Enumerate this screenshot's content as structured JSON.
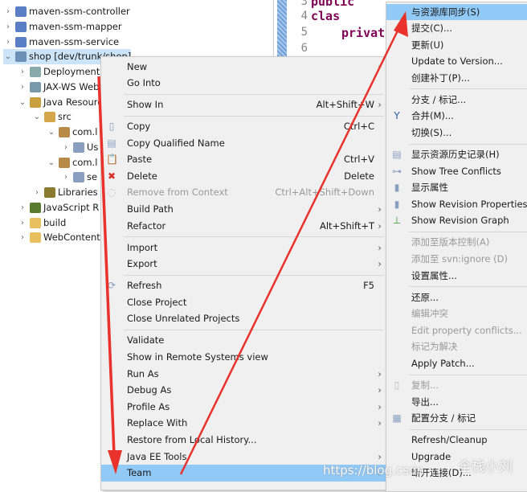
{
  "tree": [
    {
      "label": "maven-ssm-controller",
      "indent": 0,
      "chev": "›",
      "icon": "maven-project-icon",
      "color": "#5b7fc7"
    },
    {
      "label": "maven-ssm-mapper",
      "indent": 0,
      "chev": "›",
      "icon": "maven-project-icon",
      "color": "#5b7fc7"
    },
    {
      "label": "maven-ssm-service",
      "indent": 0,
      "chev": "›",
      "icon": "maven-project-icon",
      "color": "#5b7fc7"
    },
    {
      "label": "shop [dev/trunk/shop]",
      "indent": 0,
      "chev": "⌄",
      "icon": "svn-project-icon",
      "color": "#6b8fb5",
      "selected": true
    },
    {
      "label": "Deployment",
      "indent": 1,
      "chev": "›",
      "icon": "deployment-icon",
      "color": "#8aa"
    },
    {
      "label": "JAX-WS Web",
      "indent": 1,
      "chev": "›",
      "icon": "webservice-icon",
      "color": "#79a"
    },
    {
      "label": "Java Resources",
      "indent": 1,
      "chev": "⌄",
      "icon": "java-resources-icon",
      "color": "#c9a040"
    },
    {
      "label": "src",
      "indent": 2,
      "chev": "⌄",
      "icon": "source-folder-icon",
      "color": "#d6a64a"
    },
    {
      "label": "com.l",
      "indent": 3,
      "chev": "⌄",
      "icon": "package-icon",
      "color": "#b88a4a"
    },
    {
      "label": "Us",
      "indent": 4,
      "chev": "›",
      "icon": "java-file-icon",
      "color": "#8a9fc0"
    },
    {
      "label": "com.l",
      "indent": 3,
      "chev": "⌄",
      "icon": "package-icon",
      "color": "#b88a4a"
    },
    {
      "label": "se",
      "indent": 4,
      "chev": "›",
      "icon": "java-file-icon",
      "color": "#8a9fc0"
    },
    {
      "label": "Libraries",
      "indent": 2,
      "chev": "›",
      "icon": "libraries-icon",
      "color": "#8a7a30"
    },
    {
      "label": "JavaScript R",
      "indent": 1,
      "chev": "›",
      "icon": "javascript-resources-icon",
      "color": "#5a7a30"
    },
    {
      "label": "build",
      "indent": 1,
      "chev": "›",
      "icon": "folder-icon",
      "color": "#e8c060"
    },
    {
      "label": "WebContent",
      "indent": 1,
      "chev": "›",
      "icon": "folder-icon",
      "color": "#e8c060"
    }
  ],
  "editor": {
    "lines": [
      "3",
      "4",
      "5",
      "6"
    ],
    "code_line3": "public clas",
    "code_line5": "privat"
  },
  "main_menu": [
    {
      "label": "New",
      "arrow": true
    },
    {
      "label": "Go Into"
    },
    {
      "sep": true
    },
    {
      "label": "Show In",
      "shortcut": "Alt+Shift+W",
      "arrow": true
    },
    {
      "sep": true
    },
    {
      "label": "Copy",
      "shortcut": "Ctrl+C",
      "icon": "copy-icon"
    },
    {
      "label": "Copy Qualified Name",
      "icon": "copy-qualified-name-icon"
    },
    {
      "label": "Paste",
      "shortcut": "Ctrl+V",
      "icon": "paste-icon"
    },
    {
      "label": "Delete",
      "shortcut": "Delete",
      "icon": "delete-icon"
    },
    {
      "label": "Remove from Context",
      "shortcut": "Ctrl+Alt+Shift+Down",
      "disabled": true,
      "icon": "remove-context-icon"
    },
    {
      "label": "Build Path",
      "arrow": true
    },
    {
      "label": "Refactor",
      "shortcut": "Alt+Shift+T",
      "arrow": true
    },
    {
      "sep": true
    },
    {
      "label": "Import",
      "arrow": true
    },
    {
      "label": "Export",
      "arrow": true
    },
    {
      "sep": true
    },
    {
      "label": "Refresh",
      "shortcut": "F5",
      "icon": "refresh-icon"
    },
    {
      "label": "Close Project"
    },
    {
      "label": "Close Unrelated Projects"
    },
    {
      "sep": true
    },
    {
      "label": "Validate"
    },
    {
      "label": "Show in Remote Systems view"
    },
    {
      "label": "Run As",
      "arrow": true
    },
    {
      "label": "Debug As",
      "arrow": true
    },
    {
      "label": "Profile As",
      "arrow": true
    },
    {
      "label": "Replace With",
      "arrow": true
    },
    {
      "label": "Restore from Local History..."
    },
    {
      "label": "Java EE Tools",
      "arrow": true
    },
    {
      "label": "Team",
      "arrow": true,
      "highlighted": true
    }
  ],
  "team_menu": [
    {
      "label": "与资源库同步(S)",
      "highlighted": true
    },
    {
      "label": "提交(C)..."
    },
    {
      "label": "更新(U)"
    },
    {
      "label": "Update to Version..."
    },
    {
      "label": "创建补丁(P)..."
    },
    {
      "sep": true
    },
    {
      "label": "分支 / 标记..."
    },
    {
      "label": "合并(M)...",
      "icon": "merge-icon"
    },
    {
      "label": "切换(S)..."
    },
    {
      "sep": true
    },
    {
      "label": "显示资源历史记录(H)",
      "icon": "history-icon"
    },
    {
      "label": "Show Tree Conflicts",
      "icon": "tree-conflicts-icon"
    },
    {
      "label": "显示属性",
      "icon": "properties-icon"
    },
    {
      "label": "Show Revision Properties",
      "icon": "revision-properties-icon"
    },
    {
      "label": "Show Revision Graph",
      "icon": "revision-graph-icon"
    },
    {
      "sep": true
    },
    {
      "label": "添加至版本控制(A)",
      "disabled": true
    },
    {
      "label": "添加至 svn:ignore (D)",
      "disabled": true
    },
    {
      "label": "设置属性..."
    },
    {
      "sep": true
    },
    {
      "label": "还原..."
    },
    {
      "label": "编辑冲突",
      "disabled": true
    },
    {
      "label": "Edit property conflicts...",
      "disabled": true
    },
    {
      "label": "标记为解决",
      "disabled": true
    },
    {
      "label": "Apply Patch..."
    },
    {
      "sep": true
    },
    {
      "label": "复制...",
      "disabled": true,
      "icon": "copy-icon"
    },
    {
      "label": "导出..."
    },
    {
      "label": "配置分支 / 标记",
      "icon": "branch-config-icon"
    },
    {
      "sep": true
    },
    {
      "label": "Refresh/Cleanup"
    },
    {
      "label": "Upgrade"
    },
    {
      "label": "断开连接(D)..."
    }
  ],
  "watermark": {
    "url": "https://blog.csdn",
    "brand": "全栈小刘"
  },
  "colors": {
    "highlight": "#91c9f7",
    "arrow": "#e8322b",
    "menu_bg": "#f0f0f0"
  }
}
